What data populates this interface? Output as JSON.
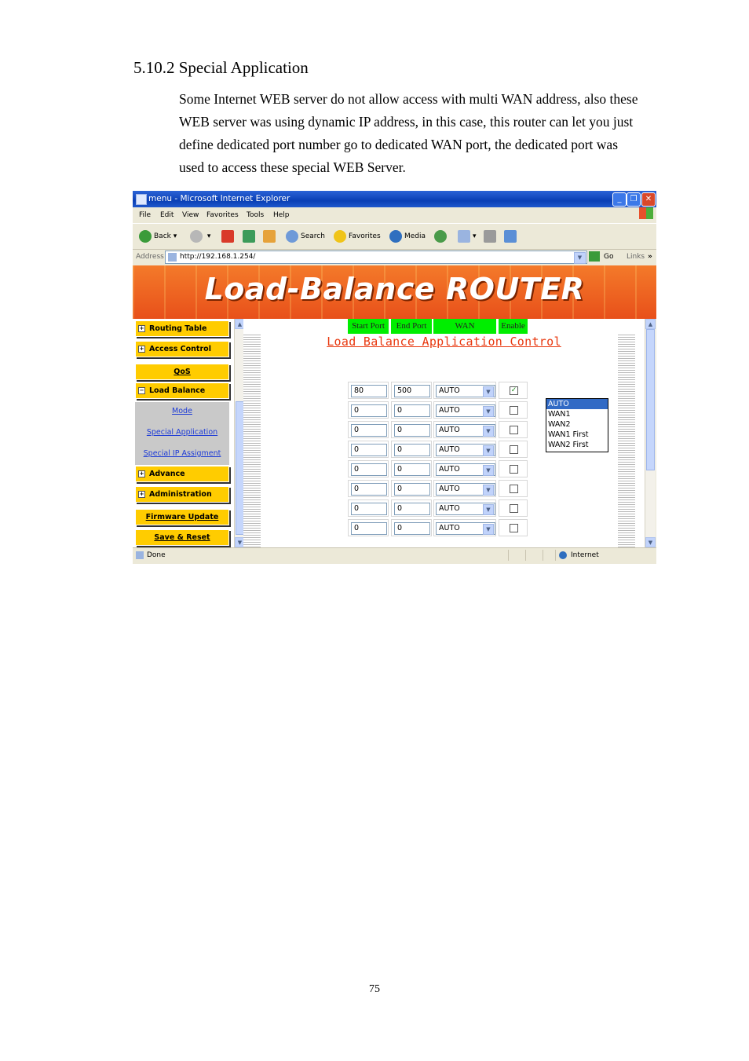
{
  "doc": {
    "section_title": "5.10.2  Special Application",
    "paragraph": "Some Internet WEB server do not allow access with multi WAN address, also these WEB server was using dynamic IP address, in this case, this router can let you just define dedicated port number go to dedicated WAN port, the dedicated port was used to access these special WEB Server.",
    "page_number": "75"
  },
  "browser": {
    "title": "menu - Microsoft Internet Explorer",
    "menu": [
      "File",
      "Edit",
      "View",
      "Favorites",
      "Tools",
      "Help"
    ],
    "toolbar": {
      "back": "Back",
      "search": "Search",
      "favorites": "Favorites",
      "media": "Media"
    },
    "address_label": "Address",
    "address": "http://192.168.1.254/",
    "go": "Go",
    "links": "Links",
    "status": "Done",
    "zone": "Internet"
  },
  "banner": {
    "title": "Load-Balance ROUTER"
  },
  "nav": {
    "routing_table": "Routing Table",
    "access_control": "Access Control",
    "qos": "QoS",
    "load_balance": "Load Balance",
    "sub": [
      "Mode",
      "Special Application",
      "Special IP Assigment"
    ],
    "advance": "Advance",
    "administration": "Administration",
    "firmware": "Firmware Update",
    "save_reset": "Save & Reset"
  },
  "content": {
    "title": "Load Balance Application Control",
    "headers": [
      "Start Port",
      "End Port",
      "WAN",
      "Enable"
    ],
    "rows": [
      {
        "start": "80",
        "end": "500",
        "wan": "AUTO",
        "enabled": true
      },
      {
        "start": "0",
        "end": "0",
        "wan": "AUTO",
        "enabled": false
      },
      {
        "start": "0",
        "end": "0",
        "wan": "AUTO",
        "enabled": false
      },
      {
        "start": "0",
        "end": "0",
        "wan": "AUTO",
        "enabled": false
      },
      {
        "start": "0",
        "end": "0",
        "wan": "AUTO",
        "enabled": false
      },
      {
        "start": "0",
        "end": "0",
        "wan": "AUTO",
        "enabled": false
      },
      {
        "start": "0",
        "end": "0",
        "wan": "AUTO",
        "enabled": false
      },
      {
        "start": "0",
        "end": "0",
        "wan": "AUTO",
        "enabled": false
      }
    ],
    "dropdown_options": [
      "AUTO",
      "WAN1",
      "WAN2",
      "WAN1 First",
      "WAN2 First"
    ]
  },
  "colors": {
    "accent_orange": "#e8501a",
    "nav_yellow": "#ffcc00",
    "header_green": "#00ee00",
    "title_red": "#e8380f"
  }
}
